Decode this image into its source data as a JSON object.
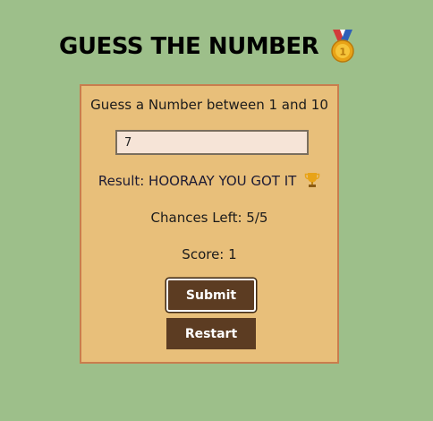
{
  "header": {
    "title": "GUESS THE NUMBER",
    "icon": "medal-icon"
  },
  "game": {
    "prompt": "Guess a Number between 1 and 10",
    "guess_value": "7",
    "result": "Result: HOORAAY YOU GOT IT",
    "result_icon": "trophy-icon",
    "chances": "Chances Left: 5/5",
    "score": "Score: 1",
    "submit_label": "Submit",
    "restart_label": "Restart"
  },
  "colors": {
    "background": "#9dbf8a",
    "card": "#e8bf7a",
    "card_border": "#c97d4e",
    "button": "#5c3c22",
    "input_bg": "#f6e4d7"
  }
}
